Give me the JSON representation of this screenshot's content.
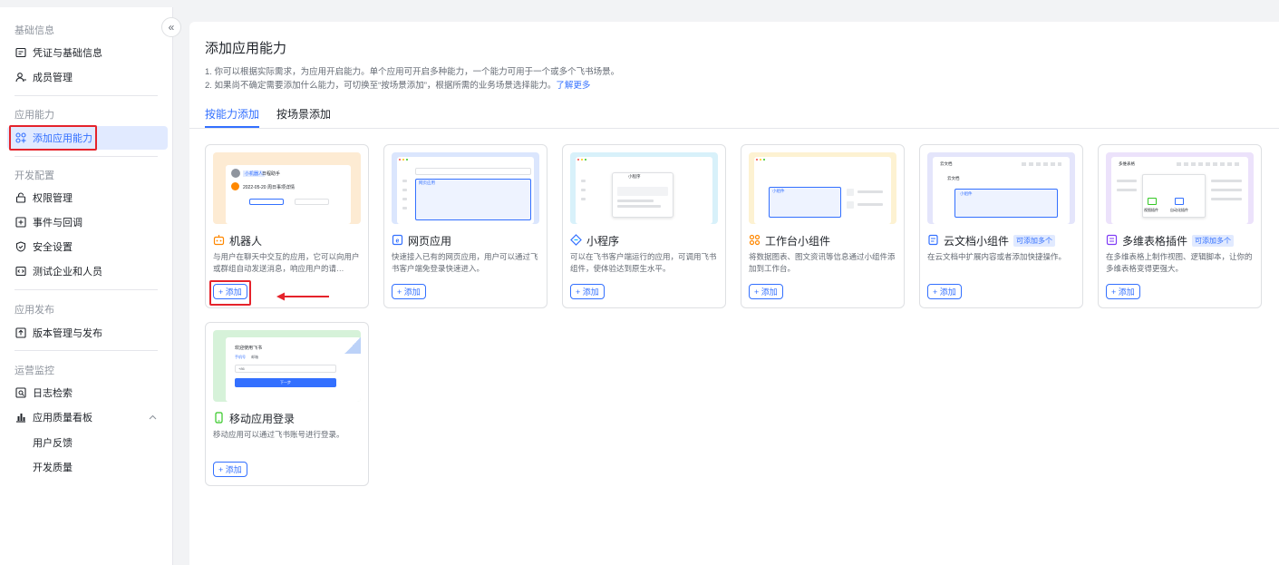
{
  "sidebar": {
    "groups": {
      "basic": "基础信息",
      "ability": "应用能力",
      "dev": "开发配置",
      "publish": "应用发布",
      "ops": "运营监控"
    },
    "items": {
      "credentials": "凭证与基础信息",
      "members": "成员管理",
      "add_ability": "添加应用能力",
      "permissions": "权限管理",
      "events": "事件与回调",
      "security": "安全设置",
      "test_org": "测试企业和人员",
      "versions": "版本管理与发布",
      "logs": "日志检索",
      "quality": "应用质量看板",
      "feedback": "用户反馈",
      "dev_quality": "开发质量"
    },
    "collapse_glyph": "«"
  },
  "main": {
    "title": "添加应用能力",
    "desc1": "1. 你可以根据实际需求，为应用开启能力。单个应用可开启多种能力，一个能力可用于一个或多个飞书场景。",
    "desc2_text": "2. 如果尚不确定需要添加什么能力，可切换至“按场景添加”，根据所需的业务场景选择能力。",
    "desc2_link": "了解更多",
    "tabs": [
      "按能力添加",
      "按场景添加"
    ],
    "add_label": "+ 添加",
    "multi_badge": "可添加多个",
    "cards": [
      {
        "title": "机器人",
        "icon": "robot-icon",
        "desc": "与用户在聊天中交互的应用，它可以向用户或群组自动发送消息，响应用户的请…",
        "bg": "#fdebd3"
      },
      {
        "title": "网页应用",
        "icon": "web-icon",
        "desc": "快速接入已有的网页应用，用户可以通过飞书客户端免登录快速进入。",
        "bg": "#dbe6fd"
      },
      {
        "title": "小程序",
        "icon": "miniapp-icon",
        "desc": "可以在飞书客户端运行的应用，可调用飞书组件，使体验达到原生水平。",
        "bg": "#d8f1fa"
      },
      {
        "title": "工作台小组件",
        "icon": "widget-icon",
        "desc": "将数据图表、图文资讯等信息通过小组件添加到工作台。",
        "bg": "#fdf2d2"
      },
      {
        "title": "云文档小组件",
        "icon": "doc-icon",
        "desc": "在云文档中扩展内容或者添加快捷操作。",
        "bg": "#e4e5fb",
        "multi": true
      },
      {
        "title": "多维表格插件",
        "icon": "table-icon",
        "desc": "在多维表格上制作视图、逻辑脚本，让你的多维表格变得更强大。",
        "bg": "#ece2fb",
        "multi": true
      },
      {
        "title": "移动应用登录",
        "icon": "mobile-icon",
        "desc": "移动应用可以通过飞书账号进行登录。",
        "bg": "#d6f2d9"
      }
    ],
    "previews": {
      "bot_tag": "小机器人",
      "bot_name": "日程助手",
      "bot_date": "2022-05-20 周日事项详情",
      "web_app": "网页应用",
      "mini_title": "小程序",
      "widget": "小组件",
      "doc_name": "云文档",
      "doc_widget": "小组件",
      "table_name": "多维表格",
      "table_view": "视图插件",
      "table_auto": "自动化插件",
      "mobile_title": "欢迎使用飞书",
      "mobile_tab1": "手机号",
      "mobile_tab2": "邮箱",
      "mobile_code": "+86",
      "mobile_next": "下一步"
    }
  }
}
